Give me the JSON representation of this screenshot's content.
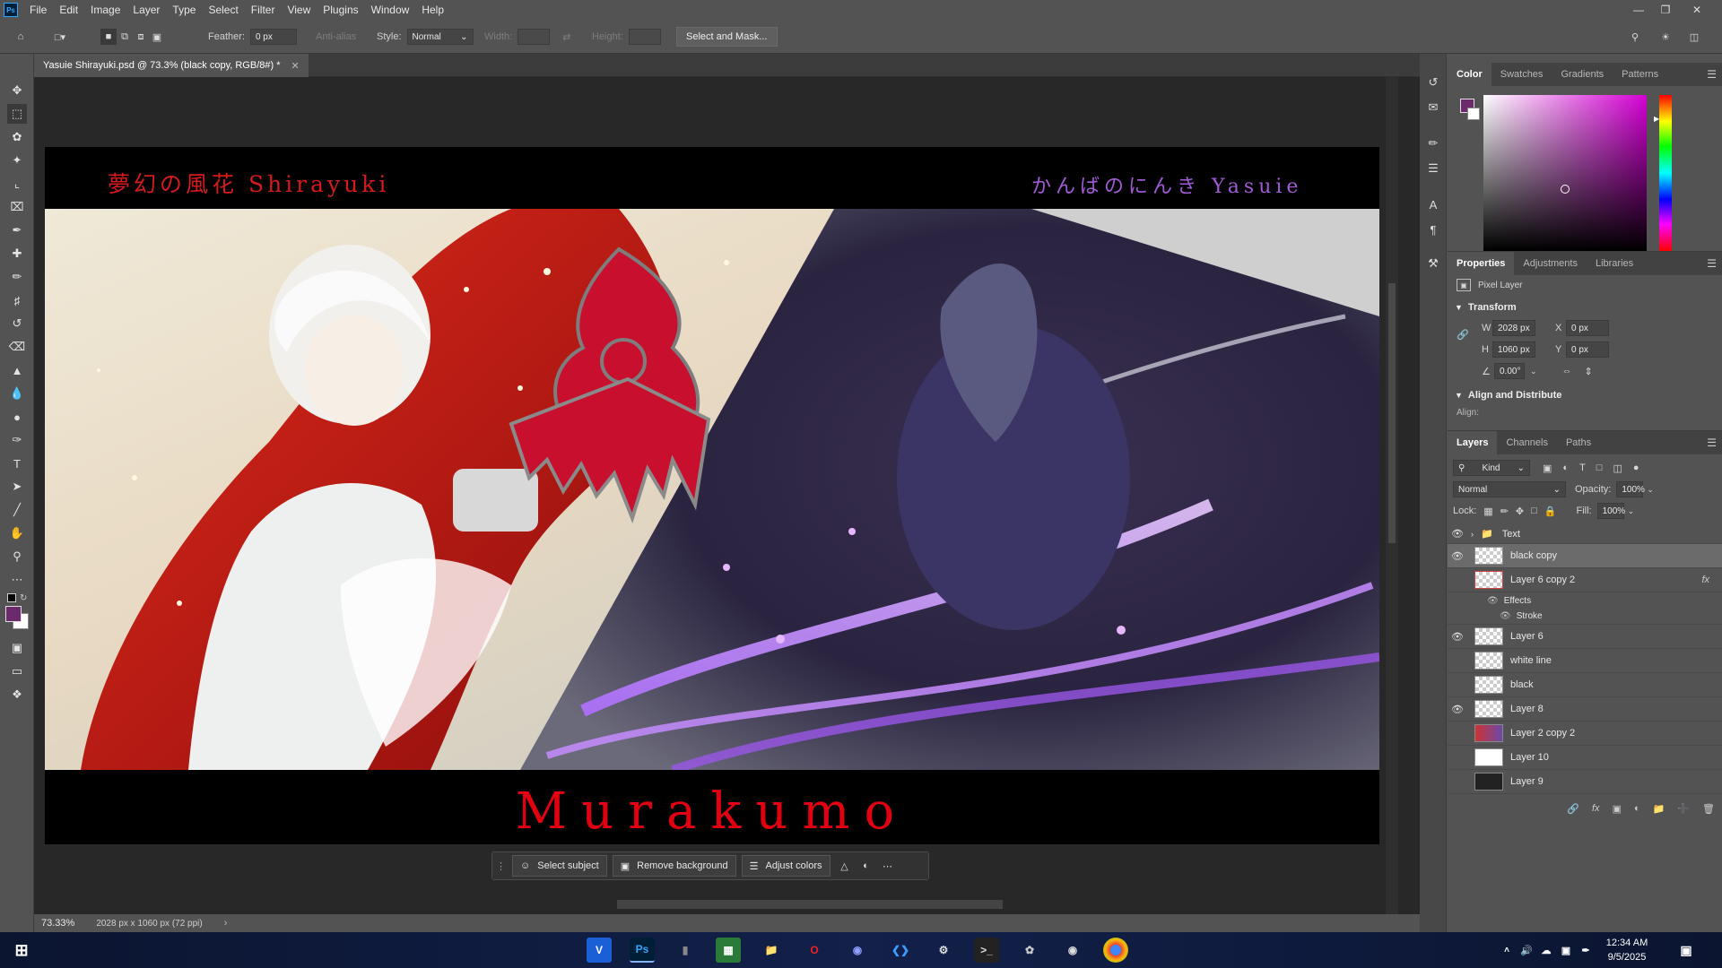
{
  "app": {
    "logo": "Ps",
    "menus": [
      "File",
      "Edit",
      "Image",
      "Layer",
      "Type",
      "Select",
      "Filter",
      "View",
      "Plugins",
      "Window",
      "Help"
    ]
  },
  "options": {
    "feather_label": "Feather:",
    "feather_value": "0 px",
    "antialias_label": "Anti-alias",
    "style_label": "Style:",
    "style_value": "Normal",
    "width_label": "Width:",
    "height_label": "Height:",
    "select_mask_button": "Select and Mask..."
  },
  "document": {
    "tab_title": "Yasuie Shirayuki.psd @ 73.3% (black copy, RGB/8#) *",
    "title_left": "夢幻の風花 Shirayuki",
    "title_right": "かんばのにんき Yasuie",
    "bottom_title": "Murakumo",
    "colors": {
      "title_left": "#d41a1a",
      "title_right": "#a15bd6",
      "bottom_title": "#e0000f",
      "emblem": "#c8102e"
    }
  },
  "status": {
    "zoom": "73.33%",
    "doc_info": "2028 px x 1060 px (72 ppi)"
  },
  "context_bar": {
    "select_subject": "Select subject",
    "remove_background": "Remove background",
    "adjust_colors": "Adjust colors"
  },
  "color_panel": {
    "tabs": [
      "Color",
      "Swatches",
      "Gradients",
      "Patterns"
    ],
    "foreground": "#6b2a6b",
    "hue": "#d400d4"
  },
  "properties_panel": {
    "tabs": [
      "Properties",
      "Adjustments",
      "Libraries"
    ],
    "kind": "Pixel Layer",
    "transform_header": "Transform",
    "w_label": "W",
    "w_value": "2028 px",
    "x_label": "X",
    "x_value": "0 px",
    "h_label": "H",
    "h_value": "1060 px",
    "y_label": "Y",
    "y_value": "0 px",
    "angle_value": "0.00°",
    "align_header": "Align and Distribute",
    "align_label": "Align:"
  },
  "layers_panel": {
    "tabs": [
      "Layers",
      "Channels",
      "Paths"
    ],
    "filter_kind": "Kind",
    "blend_mode": "Normal",
    "opacity_label": "Opacity:",
    "opacity_value": "100%",
    "lock_label": "Lock:",
    "fill_label": "Fill:",
    "fill_value": "100%",
    "layers": [
      {
        "name": "Text",
        "visible": true,
        "type": "group"
      },
      {
        "name": "black copy",
        "visible": true,
        "type": "layer",
        "selected": true
      },
      {
        "name": "Layer 6 copy 2",
        "visible": false,
        "type": "layer",
        "fx": "fx"
      },
      {
        "name": "Effects",
        "visible": false,
        "type": "effects"
      },
      {
        "name": "Stroke",
        "visible": false,
        "type": "effect"
      },
      {
        "name": "Layer 6",
        "visible": true,
        "type": "layer"
      },
      {
        "name": "white line",
        "visible": false,
        "type": "layer"
      },
      {
        "name": "black",
        "visible": false,
        "type": "layer"
      },
      {
        "name": "Layer 8",
        "visible": true,
        "type": "layer"
      },
      {
        "name": "Layer 2 copy 2",
        "visible": false,
        "type": "layer"
      },
      {
        "name": "Layer 10",
        "visible": false,
        "type": "layer"
      },
      {
        "name": "Layer 9",
        "visible": false,
        "type": "layer"
      }
    ]
  },
  "taskbar": {
    "time": "12:34 AM",
    "date": "9/5/2025",
    "apps": [
      "V",
      "Ps",
      "",
      "",
      "",
      "",
      "",
      "",
      "",
      "",
      "",
      "",
      ""
    ]
  }
}
